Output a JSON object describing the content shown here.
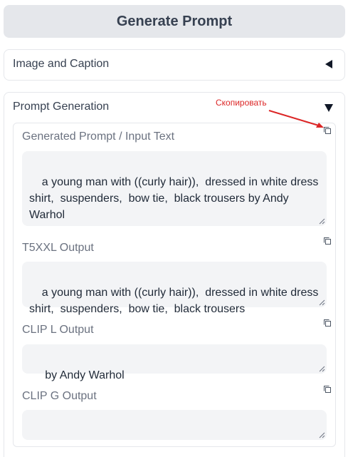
{
  "generate_button": {
    "label": "Generate Prompt"
  },
  "accordion_image_caption": {
    "title": "Image and Caption"
  },
  "accordion_prompt_generation": {
    "title": "Prompt Generation"
  },
  "annotation": {
    "text": "Скопировать",
    "color": "#dc2626"
  },
  "fields": [
    {
      "label": "Generated Prompt / Input Text",
      "value": "a young man with ((curly hair)),  dressed in white dress shirt,  suspenders,  bow tie,  black trousers by Andy Warhol"
    },
    {
      "label": "T5XXL Output",
      "value": "a young man with ((curly hair)),  dressed in white dress shirt,  suspenders,  bow tie,  black trousers"
    },
    {
      "label": "CLIP L Output",
      "value": " by Andy Warhol"
    },
    {
      "label": "CLIP G Output",
      "value": ""
    }
  ],
  "icons": {
    "collapsed_arrow": "triangle-left-icon",
    "expanded_arrow": "triangle-down-icon",
    "copy": "copy-icon",
    "resize": "resize-grip-icon"
  }
}
